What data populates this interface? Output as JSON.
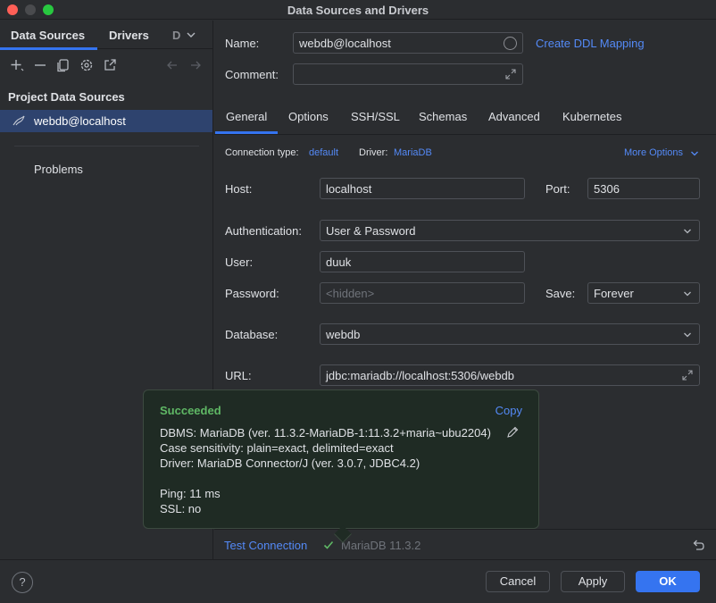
{
  "window": {
    "title": "Data Sources and Drivers"
  },
  "sidebar": {
    "tabs": [
      "Data Sources",
      "Drivers",
      "D"
    ],
    "section_title": "Project Data Sources",
    "items": [
      {
        "label": "webdb@localhost"
      }
    ],
    "problems_label": "Problems",
    "toolbar_icons": [
      "add-icon",
      "remove-icon",
      "duplicate-icon",
      "settings-icon",
      "open-icon",
      "back-icon",
      "forward-icon"
    ]
  },
  "form": {
    "name_label": "Name:",
    "name_value": "webdb@localhost",
    "create_ddl_link": "Create DDL Mapping",
    "comment_label": "Comment:",
    "comment_value": "",
    "tabs": [
      "General",
      "Options",
      "SSH/SSL",
      "Schemas",
      "Advanced",
      "Kubernetes"
    ],
    "connection_type_label": "Connection type:",
    "connection_type_value": "default",
    "driver_label": "Driver:",
    "driver_value": "MariaDB",
    "more_options": "More Options",
    "host_label": "Host:",
    "host_value": "localhost",
    "port_label": "Port:",
    "port_value": "5306",
    "auth_label": "Authentication:",
    "auth_value": "User & Password",
    "user_label": "User:",
    "user_value": "duuk",
    "password_label": "Password:",
    "password_placeholder": "<hidden>",
    "save_label": "Save:",
    "save_value": "Forever",
    "database_label": "Database:",
    "database_value": "webdb",
    "url_label": "URL:",
    "url_value": "jdbc:mariadb://localhost:5306/webdb"
  },
  "popup": {
    "status": "Succeeded",
    "copy_label": "Copy",
    "lines": [
      "DBMS: MariaDB (ver. 11.3.2-MariaDB-1:11.3.2+maria~ubu2204)",
      "Case sensitivity: plain=exact, delimited=exact",
      "Driver: MariaDB Connector/J (ver. 3.0.7, JDBC4.2)",
      "",
      "Ping: 11 ms",
      "SSL: no"
    ]
  },
  "status_bar": {
    "test_connection": "Test Connection",
    "version": "MariaDB 11.3.2"
  },
  "footer": {
    "help": "?",
    "cancel": "Cancel",
    "apply": "Apply",
    "ok": "OK"
  },
  "colors": {
    "accent": "#3574f0",
    "link": "#548af7",
    "success": "#5fb865",
    "selection": "#2e436e"
  }
}
